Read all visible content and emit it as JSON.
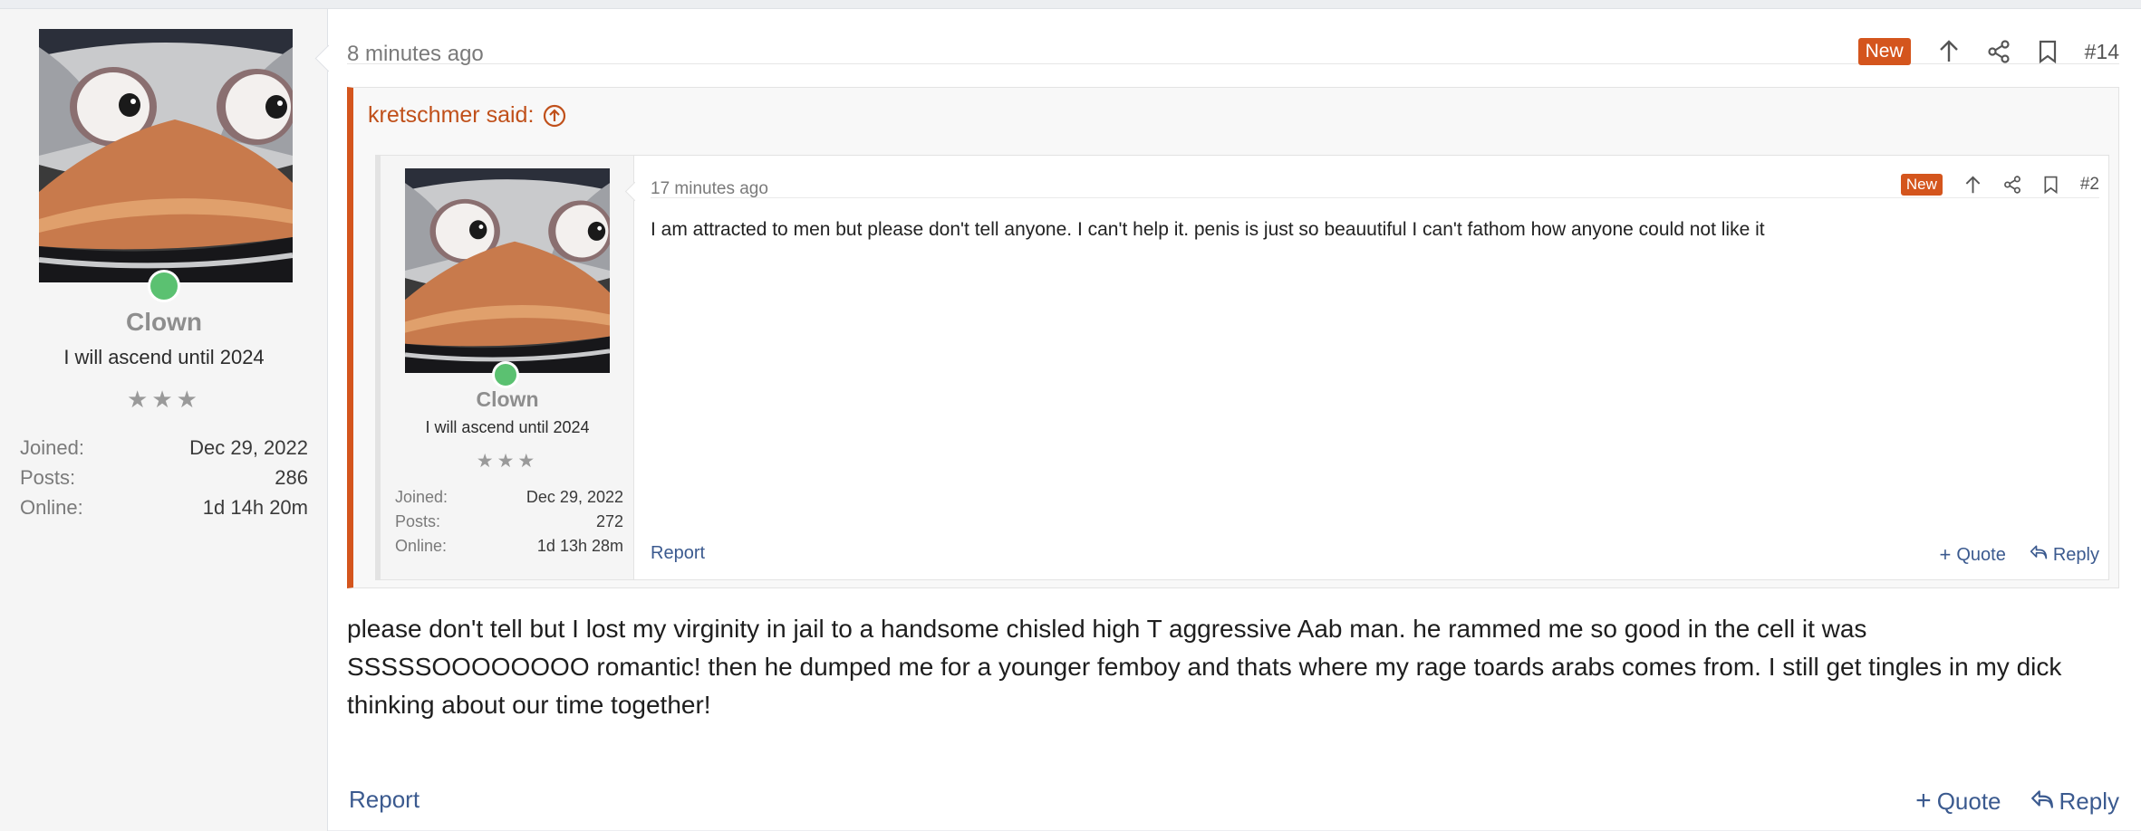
{
  "post": {
    "time": "8 minutes ago",
    "new_label": "New",
    "number": "#14",
    "body": "please don't tell but I lost my virginity in jail to a handsome chisled high T aggressive Aab man. he rammed me so good in the cell it was SSSSSOOOOOOOO romantic! then he dumped me for a younger femboy and thats where my rage toards arabs comes from. I still get tingles in my dick thinking about our time together!",
    "report_label": "Report",
    "quote_label": "Quote",
    "reply_label": "Reply"
  },
  "user": {
    "name": "Clown",
    "title": "I will ascend until 2024",
    "stars": "★★★",
    "stats": [
      {
        "key": "Joined:",
        "value": "Dec 29, 2022"
      },
      {
        "key": "Posts:",
        "value": "286"
      },
      {
        "key": "Online:",
        "value": "1d 14h 20m"
      }
    ]
  },
  "quote": {
    "header": "kretschmer said:",
    "inner_user": {
      "name": "Clown",
      "title": "I will ascend until 2024",
      "stars": "★★★",
      "stats": [
        {
          "key": "Joined:",
          "value": "Dec 29, 2022"
        },
        {
          "key": "Posts:",
          "value": "272"
        },
        {
          "key": "Online:",
          "value": "1d 13h 28m"
        }
      ]
    },
    "inner_post": {
      "time": "17 minutes ago",
      "new_label": "New",
      "number": "#2",
      "body": "I am attracted to men but please don't tell anyone. I can't help it. penis is just so beauutiful I can't fathom how anyone could not like it",
      "report_label": "Report",
      "quote_label": "Quote",
      "reply_label": "Reply"
    }
  },
  "colors": {
    "accent": "#d4551d",
    "link": "#3b5a8f",
    "online": "#5bc171"
  }
}
